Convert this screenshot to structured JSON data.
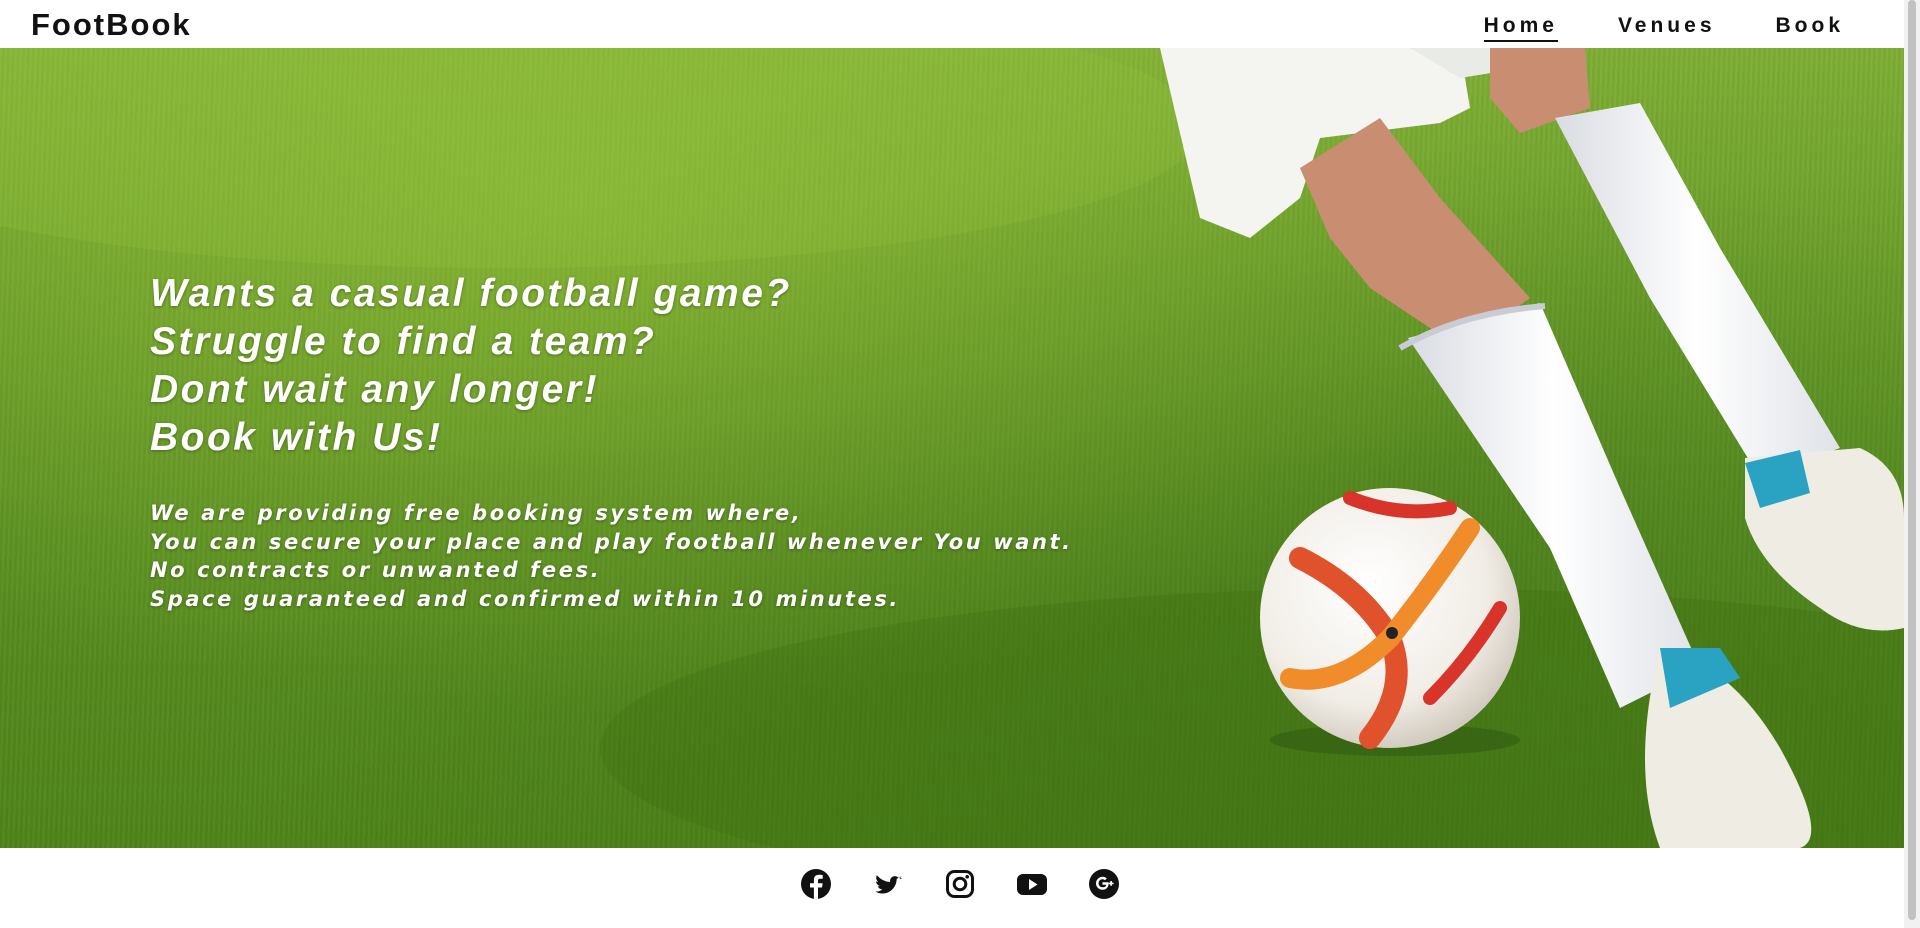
{
  "header": {
    "logo": "FootBook",
    "nav": [
      {
        "label": "Home",
        "active": true
      },
      {
        "label": "Venues",
        "active": false
      },
      {
        "label": "Book",
        "active": false
      }
    ]
  },
  "hero": {
    "headline": [
      "Wants a casual football game?",
      "Struggle to find a team?",
      "Dont wait any longer!",
      "Book with Us!"
    ],
    "blurb": [
      "We are providing free booking system where,",
      "You can secure your place and play football whenever You want.",
      "No contracts or unwanted fees.",
      "Space guaranteed and confirmed within 10 minutes."
    ]
  },
  "footer": {
    "social_icons": [
      "facebook-icon",
      "twitter-icon",
      "instagram-icon",
      "youtube-icon",
      "google-plus-icon"
    ]
  },
  "colors": {
    "header_bg": "#ffffff",
    "text_dark": "#111111",
    "hero_text": "#ffffff",
    "grass": "#6a9e2a"
  }
}
